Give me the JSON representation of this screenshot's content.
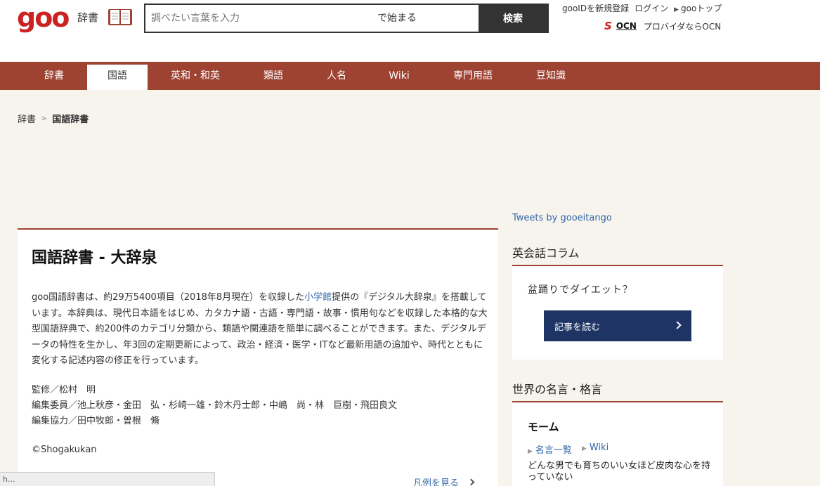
{
  "header": {
    "logo": "goo",
    "dictionary_label": "辞書",
    "search": {
      "placeholder": "調べたい言葉を入力",
      "mode": "で始まる",
      "button": "検索"
    },
    "links": [
      "gooIDを新規登録",
      "ログイン",
      "gooトップ"
    ],
    "ocn": {
      "mark": "S",
      "word": "OCN",
      "text": "プロバイダならOCN"
    }
  },
  "nav": {
    "items": [
      "辞書",
      "国語",
      "英和・和英",
      "類語",
      "人名",
      "Wiki",
      "専門用語",
      "豆知識"
    ],
    "active": "国語"
  },
  "breadcrumb": {
    "root": "辞書",
    "current": "国語辞書"
  },
  "tweets_link": "Tweets by gooeitango",
  "main": {
    "title": "国語辞書 - 大辞泉",
    "desc_before": "goo国語辞書は、約29万5400項目（2018年8月現在）を収録した",
    "desc_link": "小学館",
    "desc_after": "提供の『デジタル大辞泉』を搭載しています。本辞典は、現代日本語をはじめ、カタカナ語・古語・専門語・故事・慣用句などを収録した本格的な大型国語辞典で、約200件のカテゴリ分類から、類語や関連語を簡単に調べることができます。また、デジタルデータの特性を生かし、年3回の定期更新によって、政治・経済・医学・ITなど最新用語の追加や、時代とともに変化する記述内容の修正を行っています。",
    "credits": [
      "監修／松村　明",
      "編集委員／池上秋彦・金田　弘・杉崎一雄・鈴木丹士郎・中嶋　尚・林　巨樹・飛田良文",
      "編集協力／田中牧郎・曽根　脩"
    ],
    "copyright": "©Shogakukan",
    "legend_link": "凡例を見る"
  },
  "sidebar": {
    "column": {
      "heading": "英会話コラム",
      "question": "盆踊りでダイエット？",
      "button": "記事を読む"
    },
    "quotes": {
      "heading": "世界の名言・格言",
      "author": "モーム",
      "links": [
        "名言一覧",
        "Wiki"
      ],
      "text": "どんな男でも育ちのいい女ほど皮肉な心を持っていない"
    }
  },
  "status_bar": "h..."
}
